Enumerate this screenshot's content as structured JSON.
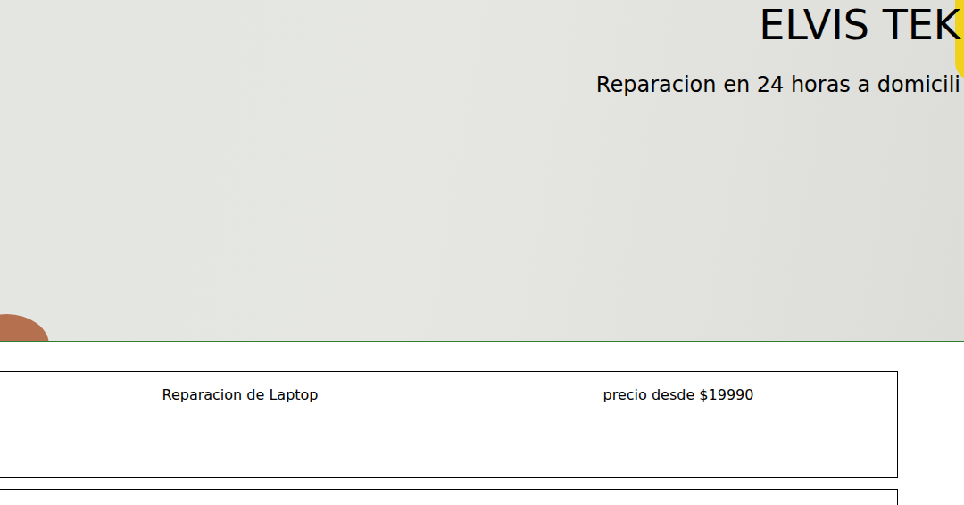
{
  "hero": {
    "title": "ELVIS TEK",
    "subtitle": "Reparacion en 24 horas a domicili"
  },
  "services": [
    {
      "name": "Reparacion de Laptop",
      "price": "precio desde $19990"
    }
  ]
}
